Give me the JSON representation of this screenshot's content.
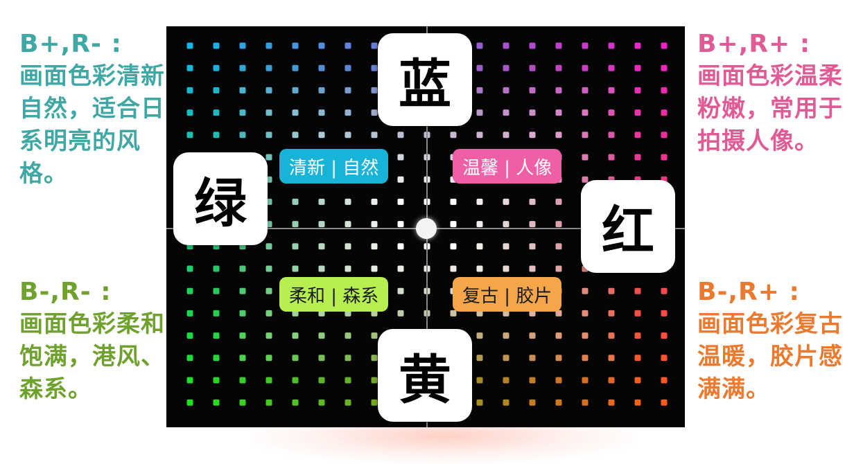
{
  "quadrants": {
    "top_left": {
      "heading": "B+,R- :",
      "text": "画面色彩清新自然，适合日系明亮的风格。",
      "color": "#3fa8a4"
    },
    "top_right": {
      "heading": "B+,R+ :",
      "text": "画面色彩温柔粉嫩，常用于拍摄人像。",
      "color": "#e05a95"
    },
    "bottom_left": {
      "heading": "B-,R- :",
      "text": "画面色彩柔和饱满，港风、森系。",
      "color": "#6fa22c"
    },
    "bottom_right": {
      "heading": "B-,R+ :",
      "text": "画面色彩复古温暖，胶片感满满。",
      "color": "#ec7a2e"
    }
  },
  "wheel": {
    "cards": {
      "blue": "蓝",
      "green": "绿",
      "red": "红",
      "yellow": "黄"
    },
    "tags": {
      "fresh": "清新 | 自然",
      "warm": "温馨 | 人像",
      "soft": "柔和 | 森系",
      "retro": "复古 | 胶片"
    }
  },
  "colors": {
    "panel_bg": "#050505",
    "axis": "#8a8a8a",
    "corner_top_left": "#12b6e6",
    "corner_top_right": "#f020c8",
    "corner_bottom_left": "#1fe01f",
    "corner_bottom_right": "#ff5a1a",
    "center": "#ffffff"
  }
}
